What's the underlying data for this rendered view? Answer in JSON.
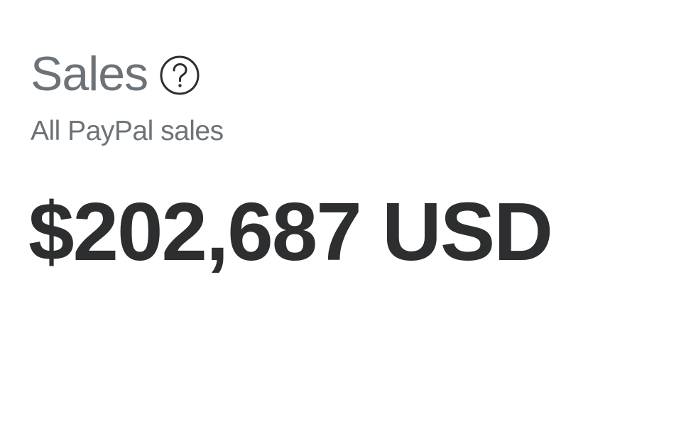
{
  "card": {
    "title": "Sales",
    "help_icon": "question-circle-icon",
    "subtitle": "All PayPal sales",
    "amount": "$202,687 USD"
  },
  "colors": {
    "title": "#6c7378",
    "subtitle": "#6c7378",
    "amount": "#2c2e2f",
    "icon_stroke": "#2c2e2f",
    "background": "#ffffff"
  }
}
